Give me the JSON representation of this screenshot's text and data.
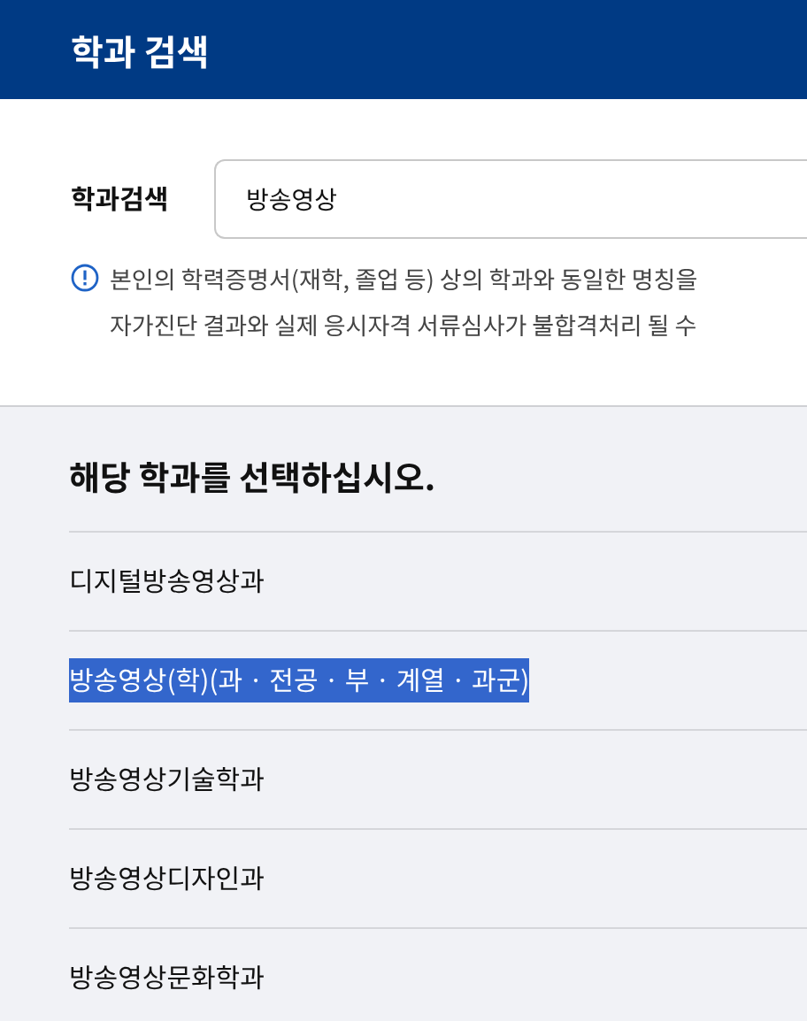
{
  "header": {
    "title": "학과 검색"
  },
  "search": {
    "label": "학과검색",
    "value": "방송영상"
  },
  "notice": [
    "본인의 학력증명서(재학, 졸업 등) 상의 학과와 동일한 명칭을",
    "자가진단 결과와 실제 응시자격 서류심사가 불합격처리 될 수"
  ],
  "results": {
    "heading": "해당 학과를 선택하십시오.",
    "items": [
      {
        "label": "디지털방송영상과",
        "selected": false
      },
      {
        "label": "방송영상(학)(과 · 전공 · 부 · 계열 · 과군)",
        "selected": true
      },
      {
        "label": "방송영상기술학과",
        "selected": false
      },
      {
        "label": "방송영상디자인과",
        "selected": false
      },
      {
        "label": "방송영상문화학과",
        "selected": false
      }
    ]
  }
}
